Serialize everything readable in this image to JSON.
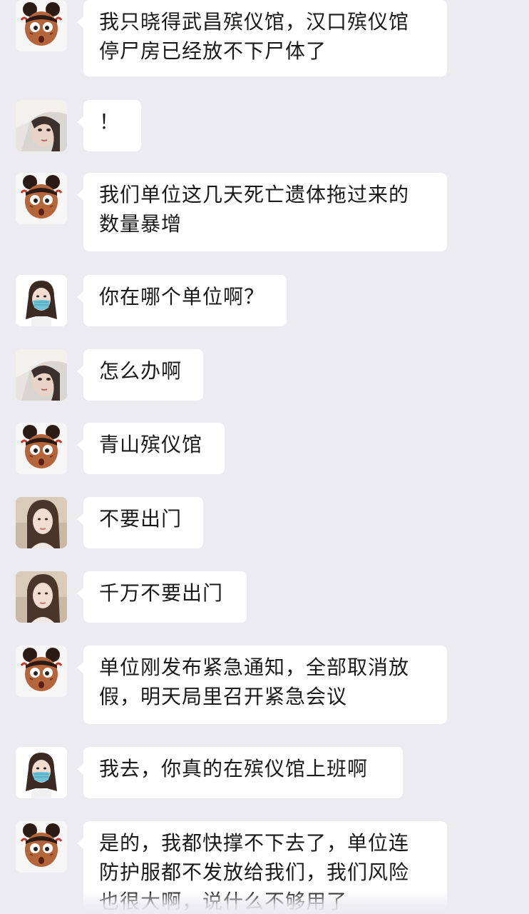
{
  "messages": [
    {
      "sender": "cartoon-boy",
      "text": "我只晓得武昌殡仪馆，汉口殡仪馆\n停尸房已经放不下尸体了"
    },
    {
      "sender": "girl-blanket",
      "text": "！"
    },
    {
      "sender": "cartoon-boy",
      "text": "我们单位这几天死亡遗体拖过来的\n数量暴增"
    },
    {
      "sender": "girl-mask",
      "text": "你在哪个单位啊？"
    },
    {
      "sender": "girl-blanket",
      "text": "怎么办啊"
    },
    {
      "sender": "cartoon-boy",
      "text": "青山殡仪馆"
    },
    {
      "sender": "girl-photo",
      "text": "不要出门"
    },
    {
      "sender": "girl-photo",
      "text": "千万不要出门"
    },
    {
      "sender": "cartoon-boy",
      "text": "单位刚发布紧急通知，全部取消放\n假，明天局里召开紧急会议"
    },
    {
      "sender": "girl-mask",
      "text": "我去，你真的在殡仪馆上班啊"
    },
    {
      "sender": "cartoon-boy",
      "text": "是的，我都快撑不下去了，单位连\n防护服都不发放给我们，我们风险\n也很大啊，说什么不够用了"
    }
  ],
  "colors": {
    "background": "#ecebef",
    "bubble": "#ffffff",
    "text": "#1a1a1a"
  }
}
